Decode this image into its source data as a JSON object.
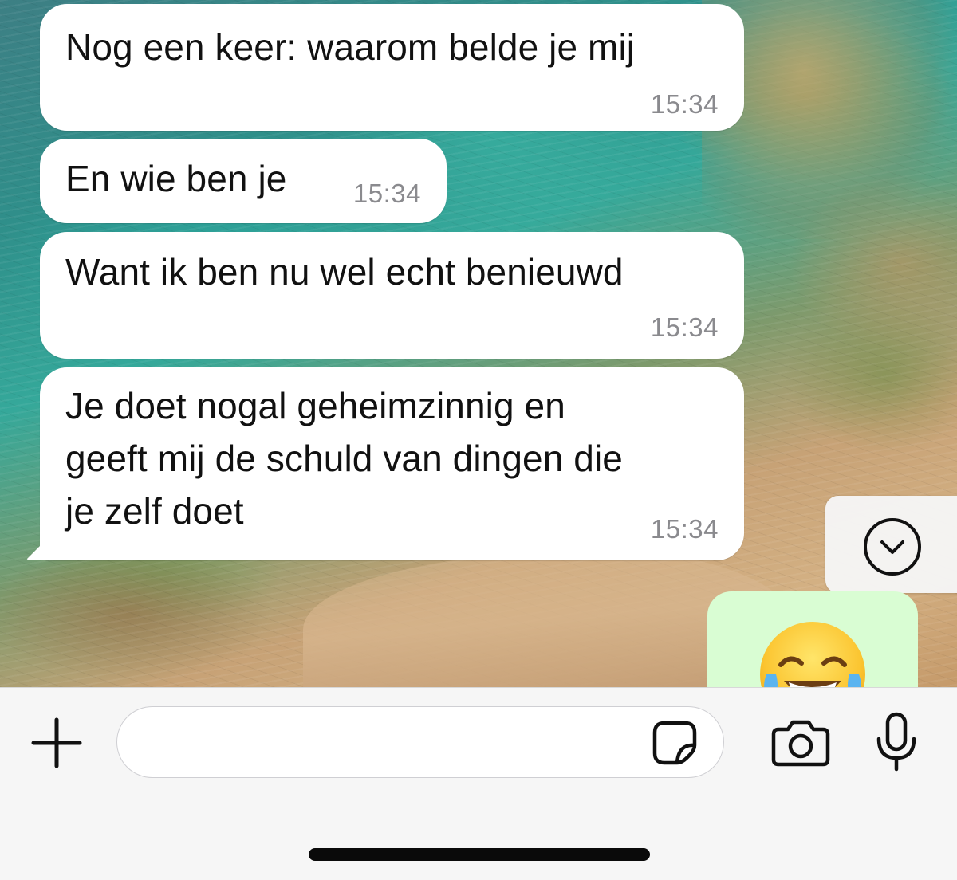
{
  "messages": [
    {
      "text": "Nog een keer: waarom belde je mij",
      "time": "15:34",
      "direction": "incoming"
    },
    {
      "text": "En wie ben je",
      "time": "15:34",
      "direction": "incoming"
    },
    {
      "text": "Want ik ben nu wel echt benieuwd",
      "time": "15:34",
      "direction": "incoming"
    },
    {
      "text": "Je doet nogal geheimzinnig en\ngeeft mij de schuld van dingen die\nje zelf doet",
      "time": "15:34",
      "direction": "incoming"
    }
  ],
  "outgoing_preview": {
    "emoji": "face-with-tears-of-joy",
    "bubble_color": "#d9fdd3"
  },
  "scroll_button": {
    "icon": "chevron-down-circle-icon"
  },
  "input_bar": {
    "placeholder": "",
    "icons": {
      "add": "plus-icon",
      "sticker": "sticker-icon",
      "camera": "camera-icon",
      "microphone": "microphone-icon"
    }
  },
  "colors": {
    "incoming_bubble": "#ffffff",
    "outgoing_bubble": "#d9fdd3",
    "timestamp": "#8a8a8e",
    "input_bar_bg": "#f6f6f6"
  }
}
